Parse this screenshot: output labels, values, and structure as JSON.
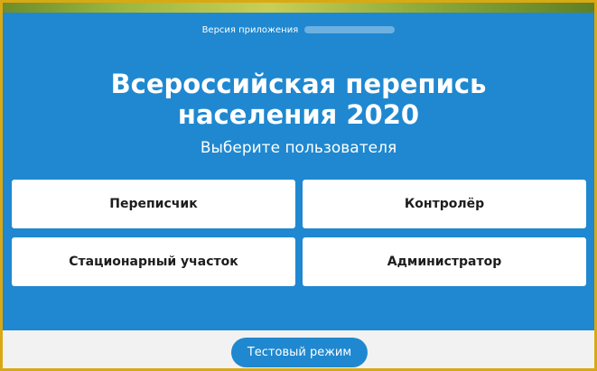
{
  "app": {
    "version_label": "Версия приложения",
    "title_line1": "Всероссийская перепись",
    "title_line2": "населения 2020",
    "subtitle": "Выберите пользователя"
  },
  "users": [
    {
      "label": "Переписчик"
    },
    {
      "label": "Контролёр"
    },
    {
      "label": "Стационарный участок"
    },
    {
      "label": "Администратор"
    }
  ],
  "footer": {
    "test_mode_label": "Тестовый режим"
  },
  "colors": {
    "primary": "#1f88d0",
    "button_bg": "#ffffff",
    "frame": "#d8a914"
  }
}
